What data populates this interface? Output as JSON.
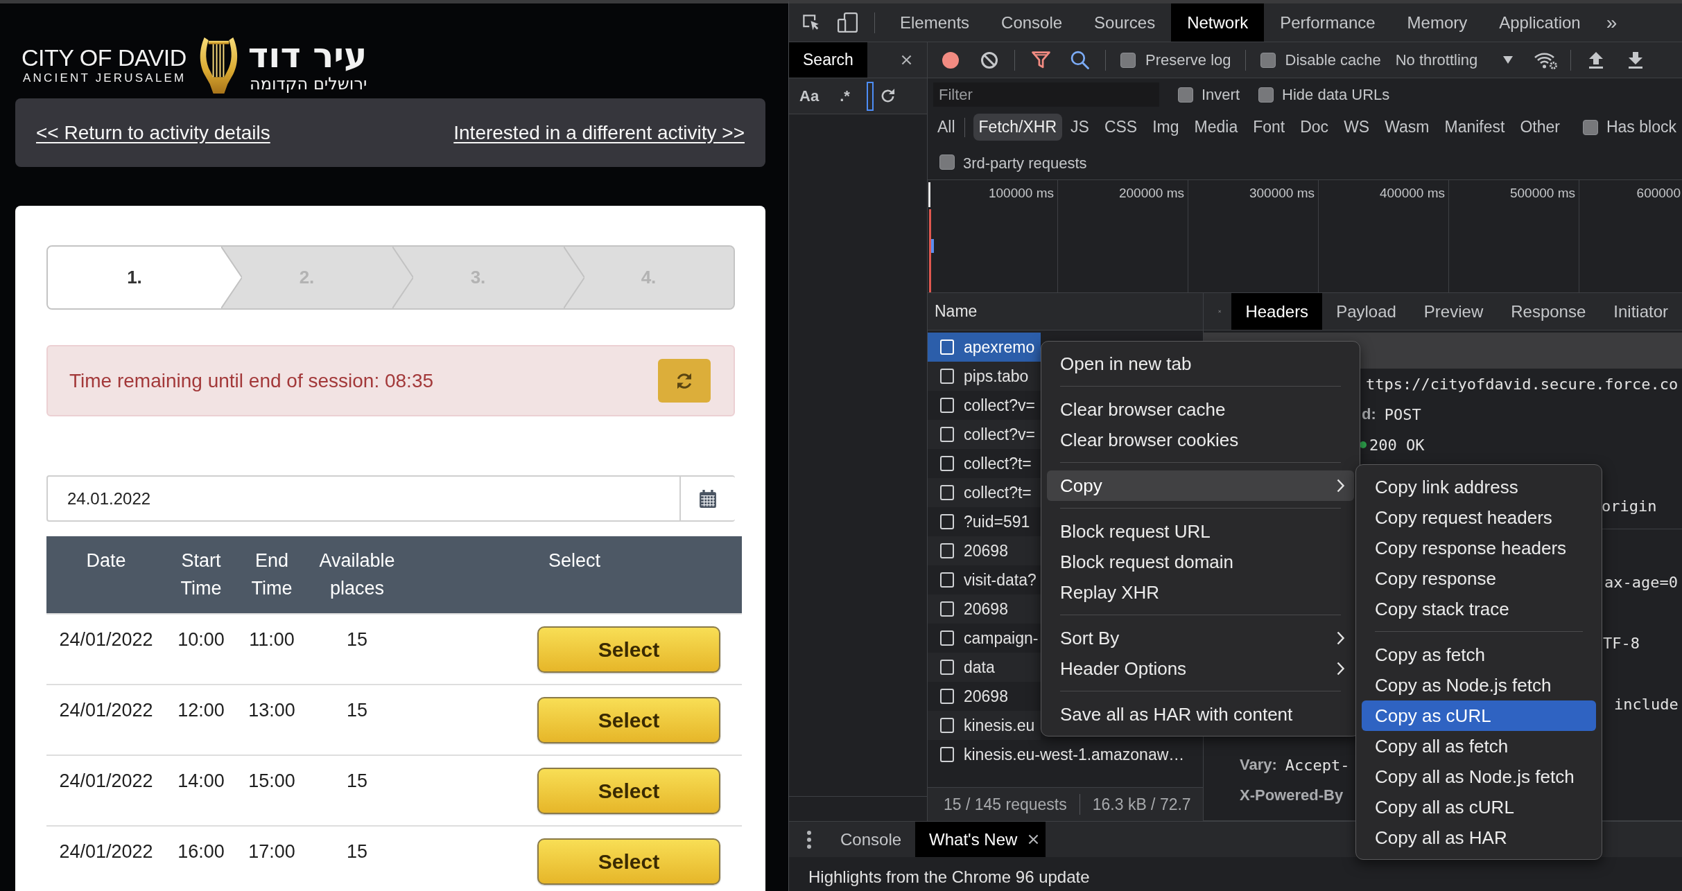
{
  "page": {
    "logo": {
      "title": "CITY OF DAVID",
      "subtitle": "ANCIENT JERUSALEM",
      "title_he": "עיר דוד",
      "subtitle_he": "ירושלים הקדומה"
    },
    "nav_links": [
      "<< Return to activity details",
      "Interested in a different activity >>"
    ],
    "steps": [
      {
        "label": "1.",
        "selected": true
      },
      {
        "label": "2.",
        "selected": false
      },
      {
        "label": "3.",
        "selected": false
      },
      {
        "label": "4.",
        "selected": false
      }
    ],
    "session_alert": {
      "text": "Time remaining until end of session: 08:35"
    },
    "date_field": {
      "value": "24.01.2022"
    },
    "table": {
      "columns": [
        "Date",
        "Start Time",
        "End Time",
        "Available places",
        "Select"
      ],
      "rows": [
        {
          "date": "24/01/2022",
          "start": "10:00",
          "end": "11:00",
          "places": "15",
          "action": "Select"
        },
        {
          "date": "24/01/2022",
          "start": "12:00",
          "end": "13:00",
          "places": "15",
          "action": "Select"
        },
        {
          "date": "24/01/2022",
          "start": "14:00",
          "end": "15:00",
          "places": "15",
          "action": "Select"
        },
        {
          "date": "24/01/2022",
          "start": "16:00",
          "end": "17:00",
          "places": "15",
          "action": "Select"
        }
      ]
    }
  },
  "devtools": {
    "tabs": [
      {
        "label": "Elements",
        "selected": false
      },
      {
        "label": "Console",
        "selected": false
      },
      {
        "label": "Sources",
        "selected": false
      },
      {
        "label": "Network",
        "selected": true
      },
      {
        "label": "Performance",
        "selected": false
      },
      {
        "label": "Memory",
        "selected": false
      },
      {
        "label": "Application",
        "selected": false
      }
    ],
    "more_tabs": "»",
    "sidebar": {
      "tab": "Search",
      "options": [
        "Aa",
        ".*"
      ]
    },
    "toolbar": {
      "recording": true,
      "filter_active": true,
      "search_active": true,
      "checkboxes": [
        {
          "label": "Preserve log",
          "checked": false
        },
        {
          "label": "Disable cache",
          "checked": false
        }
      ],
      "throttling": "No throttling"
    },
    "filter": {
      "placeholder": "Filter",
      "checkboxes": [
        {
          "label": "Invert",
          "checked": false
        },
        {
          "label": "Hide data URLs",
          "checked": false
        }
      ]
    },
    "type_filters": [
      {
        "label": "All",
        "selected": false
      },
      {
        "label": "Fetch/XHR",
        "selected": true
      },
      {
        "label": "JS",
        "selected": false
      },
      {
        "label": "CSS",
        "selected": false
      },
      {
        "label": "Img",
        "selected": false
      },
      {
        "label": "Media",
        "selected": false
      },
      {
        "label": "Font",
        "selected": false
      },
      {
        "label": "Doc",
        "selected": false
      },
      {
        "label": "WS",
        "selected": false
      },
      {
        "label": "Wasm",
        "selected": false
      },
      {
        "label": "Manifest",
        "selected": false
      },
      {
        "label": "Other",
        "selected": false
      }
    ],
    "blocked_filter": {
      "label": "Has block",
      "checked": false
    },
    "third_party_filter": {
      "label": "3rd-party requests",
      "checked": false
    },
    "overview": {
      "ticks": [
        "100000 ms",
        "200000 ms",
        "300000 ms",
        "400000 ms",
        "500000 ms",
        "600000"
      ]
    },
    "requests": {
      "column": "Name",
      "rows": [
        {
          "name": "apexremo",
          "selected": true
        },
        {
          "name": "pips.tabo",
          "selected": false
        },
        {
          "name": "collect?v=",
          "selected": false
        },
        {
          "name": "collect?v=",
          "selected": false
        },
        {
          "name": "collect?t=",
          "selected": false
        },
        {
          "name": "collect?t=",
          "selected": false
        },
        {
          "name": "?uid=591",
          "selected": false
        },
        {
          "name": "20698",
          "selected": false
        },
        {
          "name": "visit-data?",
          "selected": false
        },
        {
          "name": "20698",
          "selected": false
        },
        {
          "name": "campaign-",
          "selected": false
        },
        {
          "name": "data",
          "selected": false
        },
        {
          "name": "20698",
          "selected": false
        },
        {
          "name": "kinesis.eu",
          "selected": false
        },
        {
          "name": "kinesis.eu-west-1.amazonaw…",
          "selected": false
        }
      ],
      "summary": [
        "15 / 145 requests",
        "16.3 kB / 72.7"
      ]
    },
    "details": {
      "tabs": [
        {
          "label": "Headers",
          "selected": true
        },
        {
          "label": "Payload",
          "selected": false
        },
        {
          "label": "Preview",
          "selected": false
        },
        {
          "label": "Response",
          "selected": false
        },
        {
          "label": "Initiator",
          "selected": false
        }
      ],
      "lines": [
        {
          "kind": "value",
          "value": "ttps://cityofdavid.secure.force.co"
        },
        {
          "kind": "field",
          "name": "d:",
          "value": "POST"
        },
        {
          "kind": "status",
          "value": "200 OK"
        },
        {
          "kind": "value",
          "value": "origin"
        },
        {
          "kind": "value",
          "value": "ax-age=0"
        },
        {
          "kind": "value",
          "value": "TF-8"
        },
        {
          "kind": "value",
          "value": "include"
        },
        {
          "kind": "field",
          "name": "Vary:",
          "value": "Accept-"
        },
        {
          "kind": "name",
          "name": "X-Powered-By"
        }
      ]
    },
    "context_menu": {
      "groups": [
        [
          {
            "label": "Open in new tab",
            "submenu": false,
            "selected": false
          }
        ],
        [
          {
            "label": "Clear browser cache",
            "submenu": false,
            "selected": false
          },
          {
            "label": "Clear browser cookies",
            "submenu": false,
            "selected": false
          }
        ],
        [
          {
            "label": "Copy",
            "submenu": true,
            "selected": true
          }
        ],
        [
          {
            "label": "Block request URL",
            "submenu": false,
            "selected": false
          },
          {
            "label": "Block request domain",
            "submenu": false,
            "selected": false
          },
          {
            "label": "Replay XHR",
            "submenu": false,
            "selected": false
          }
        ],
        [
          {
            "label": "Sort By",
            "submenu": true,
            "selected": false
          },
          {
            "label": "Header Options",
            "submenu": true,
            "selected": false
          }
        ],
        [
          {
            "label": "Save all as HAR with content",
            "submenu": false,
            "selected": false
          }
        ]
      ]
    },
    "copy_submenu": {
      "groups": [
        [
          {
            "label": "Copy link address",
            "submenu": false,
            "selected": false
          },
          {
            "label": "Copy request headers",
            "submenu": false,
            "selected": false
          },
          {
            "label": "Copy response headers",
            "submenu": false,
            "selected": false
          },
          {
            "label": "Copy response",
            "submenu": false,
            "selected": false
          },
          {
            "label": "Copy stack trace",
            "submenu": false,
            "selected": false
          }
        ],
        [
          {
            "label": "Copy as fetch",
            "submenu": false,
            "selected": false
          },
          {
            "label": "Copy as Node.js fetch",
            "submenu": false,
            "selected": false
          },
          {
            "label": "Copy as cURL",
            "submenu": false,
            "selected": true
          },
          {
            "label": "Copy all as fetch",
            "submenu": false,
            "selected": false
          },
          {
            "label": "Copy all as Node.js fetch",
            "submenu": false,
            "selected": false
          },
          {
            "label": "Copy all as cURL",
            "submenu": false,
            "selected": false
          },
          {
            "label": "Copy all as HAR",
            "submenu": false,
            "selected": false
          }
        ]
      ]
    },
    "drawer": {
      "tabs": [
        {
          "label": "Console",
          "selected": false,
          "closable": false
        },
        {
          "label": "What's New",
          "selected": true,
          "closable": true
        }
      ],
      "text": "Highlights from the Chrome 96 update"
    }
  }
}
